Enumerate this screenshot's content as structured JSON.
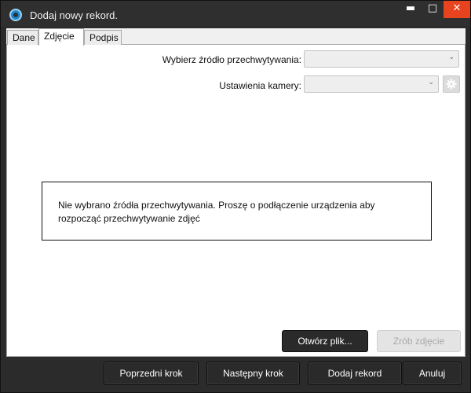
{
  "window": {
    "title": "Dodaj nowy rekord.",
    "controls": {
      "minimize": "▬",
      "maximize": "□",
      "close": "✕"
    }
  },
  "tabs": [
    {
      "label": "Dane",
      "active": false
    },
    {
      "label": "Zdjęcie",
      "active": true
    },
    {
      "label": "Podpis",
      "active": false
    }
  ],
  "form": {
    "source_label": "Wybierz źródło przechwytywania:",
    "source_value": "",
    "camera_label": "Ustawienia kamery:",
    "camera_value": "",
    "chevron": "⌄"
  },
  "message": "Nie wybrano źródła przechwytywania. Proszę o podłączenie urządzenia aby rozpocząć przechwytywanie zdjęć",
  "actions": {
    "open_file": "Otwórz plik...",
    "take_photo": "Zrób zdjęcie"
  },
  "footer": {
    "prev": "Poprzedni krok",
    "next": "Następny krok",
    "add": "Dodaj rekord",
    "cancel": "Anuluj"
  },
  "colors": {
    "accent_close": "#e8431f",
    "titlebar": "#2f2f2f",
    "dark_button": "#2a2a2a"
  }
}
